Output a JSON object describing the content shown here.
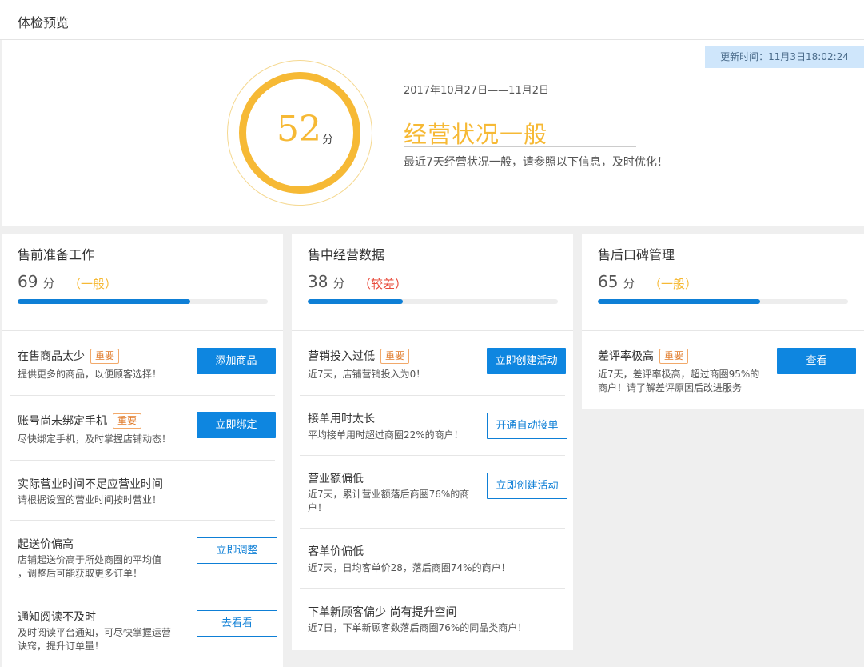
{
  "page": {
    "title": "体检预览"
  },
  "summary": {
    "update_time": "更新时间：11月3日18:02:24",
    "score": "52",
    "score_unit": "分",
    "date_range": "2017年10月27日——11月2日",
    "status": "经营状况一般",
    "status_desc": "最近7天经营状况一般，请参照以下信息，及时优化！",
    "ring_color": "#f6b935"
  },
  "colors": {
    "accent": "#0e86e0",
    "warning": "#f6b935",
    "danger": "#e84a3a"
  },
  "columns": [
    {
      "title": "售前准备工作",
      "score": "69",
      "unit": "分",
      "level": "（一般）",
      "progress": 0.69,
      "items": [
        {
          "title": "在售商品太少",
          "badge": "重要",
          "desc": "提供更多的商品，以便顾客选择！",
          "button": "添加商品"
        },
        {
          "title": "账号尚未绑定手机",
          "badge": "重要",
          "desc": "尽快绑定手机，及时掌握店铺动态！",
          "button": "立即绑定"
        },
        {
          "title": "实际营业时间不足应营业时间",
          "desc": "请根据设置的营业时间按时营业！"
        },
        {
          "title": "起送价偏高",
          "desc_lines": [
            "店铺起送价高于所处商圈的平均值",
            "，调整后可能获取更多订单！"
          ],
          "button": "立即调整"
        },
        {
          "title": "通知阅读不及时",
          "desc_lines": [
            "及时阅读平台通知，可尽快掌握运营",
            "诀窍，提升订单量！"
          ],
          "button": "去看看"
        }
      ]
    },
    {
      "title": "售中经营数据",
      "score": "38",
      "unit": "分",
      "level": "（较差）",
      "progress": 0.38,
      "items": [
        {
          "title": "营销投入过低",
          "badge": "重要",
          "desc": "近7天，店铺营销投入为0！",
          "button": "立即创建活动"
        },
        {
          "title": "接单用时太长",
          "desc": "平均接单用时超过商圈22%的商户！",
          "button": "开通自动接单"
        },
        {
          "title": "营业额偏低",
          "desc_lines": [
            "近7天，累计营业额落后商圈76%的商",
            "户！"
          ],
          "button": "立即创建活动"
        },
        {
          "title": "客单价偏低",
          "desc": "近7天，日均客单价28，落后商圈74%的商户！"
        },
        {
          "title": "下单新顾客偏少 尚有提升空间",
          "desc": "近7日，下单新顾客数落后商圈76%的同品类商户！"
        }
      ]
    },
    {
      "title": "售后口碑管理",
      "score": "65",
      "unit": "分",
      "level": "（一般）",
      "progress": 0.65,
      "items": [
        {
          "title": "差评率极高",
          "badge": "重要",
          "desc_lines": [
            "近7天，差评率极高，超过商圈95%的",
            "商户！请了解差评原因后改进服务"
          ],
          "button": "查看"
        }
      ]
    }
  ]
}
